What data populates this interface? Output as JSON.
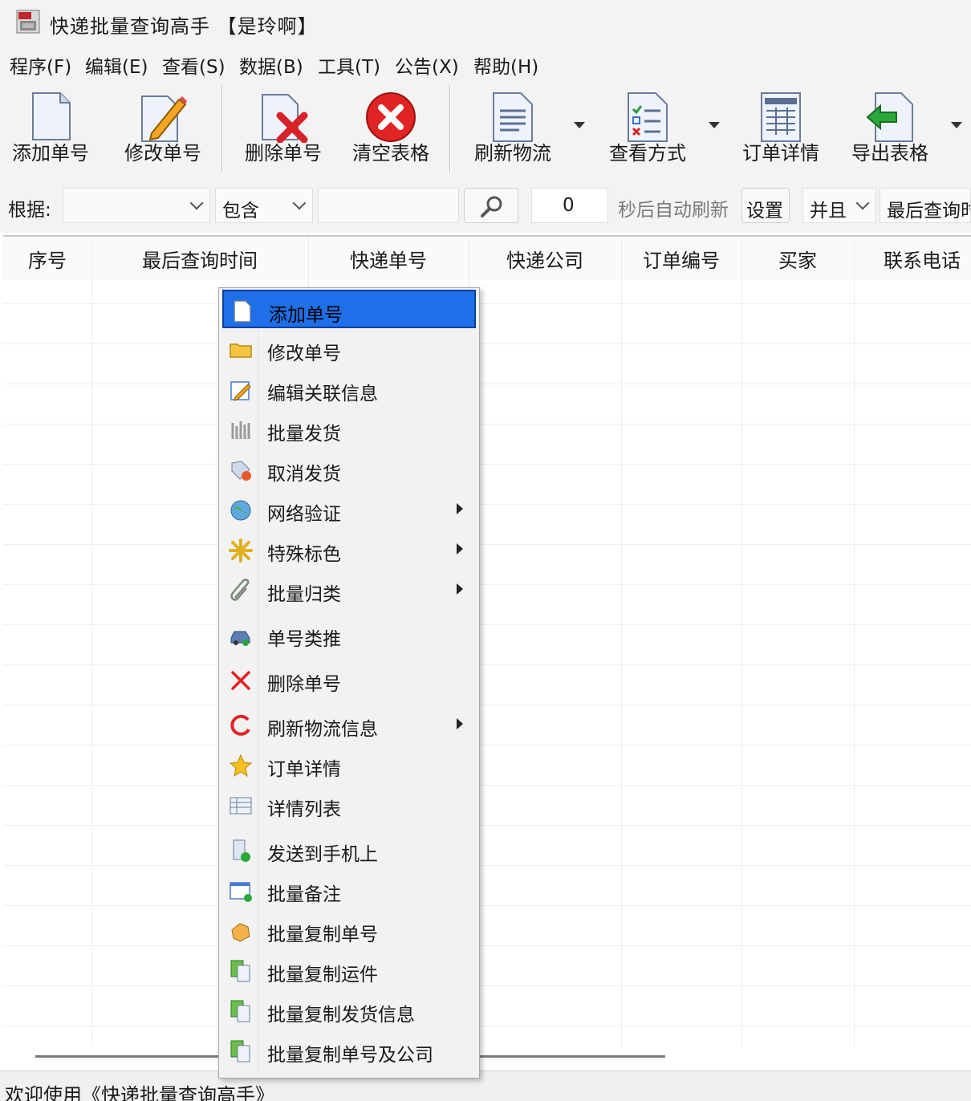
{
  "window": {
    "title": "快递批量查询高手 【是玲啊】"
  },
  "menubar": [
    "程序(F)",
    "编辑(E)",
    "查看(S)",
    "数据(B)",
    "工具(T)",
    "公告(X)",
    "帮助(H)"
  ],
  "toolbar": {
    "add": "添加单号",
    "edit": "修改单号",
    "delete": "删除单号",
    "clear": "清空表格",
    "refresh": "刷新物流",
    "view_mode": "查看方式",
    "order_detail": "订单详情",
    "export": "导出表格"
  },
  "filter": {
    "label": "根据:",
    "field_value": "",
    "match_value": "包含",
    "query_value": "",
    "seconds_value": "0",
    "auto_refresh_label": "秒后自动刷新",
    "settings_button": "设置",
    "logic_value": "并且",
    "last_query_label": "最后查询时"
  },
  "grid": {
    "columns": [
      "序号",
      "最后查询时间",
      "快递单号",
      "快递公司",
      "订单编号",
      "买家",
      "联系电话"
    ]
  },
  "context_menu": {
    "items": [
      {
        "label": "添加单号",
        "icon": "blank-page-icon",
        "submenu": false,
        "selected": true
      },
      {
        "label": "修改单号",
        "icon": "folder-icon",
        "submenu": false
      },
      {
        "label": "编辑关联信息",
        "icon": "edit-pencil-icon",
        "submenu": false
      },
      {
        "label": "批量发货",
        "icon": "bars-icon",
        "submenu": false
      },
      {
        "label": "取消发货",
        "icon": "tag-cancel-icon",
        "submenu": false
      },
      {
        "label": "网络验证",
        "icon": "globe-icon",
        "submenu": true
      },
      {
        "label": "特殊标色",
        "icon": "star-burst-icon",
        "submenu": true
      },
      {
        "label": "批量归类",
        "icon": "paperclip-icon",
        "submenu": true
      },
      {
        "label": "单号类推",
        "icon": "car-icon",
        "submenu": false
      },
      {
        "label": "删除单号",
        "icon": "red-x-icon",
        "submenu": false
      },
      {
        "label": "刷新物流信息",
        "icon": "refresh-icon",
        "submenu": true
      },
      {
        "label": "订单详情",
        "icon": "star-icon",
        "submenu": false
      },
      {
        "label": "详情列表",
        "icon": "list-table-icon",
        "submenu": false
      },
      {
        "label": "发送到手机上",
        "icon": "send-phone-icon",
        "submenu": false
      },
      {
        "label": "批量备注",
        "icon": "note-window-icon",
        "submenu": false
      },
      {
        "label": "批量复制单号",
        "icon": "hand-copy-icon",
        "submenu": false
      },
      {
        "label": "批量复制运件",
        "icon": "copy-docs-icon",
        "submenu": false
      },
      {
        "label": "批量复制发货信息",
        "icon": "copy-docs-icon",
        "submenu": false
      },
      {
        "label": "批量复制单号及公司",
        "icon": "copy-docs-icon",
        "submenu": false
      }
    ]
  },
  "status": {
    "text": "欢迎使用《快递批量查询高手》"
  },
  "colors": {
    "selection": "#1e6fe8",
    "chrome": "#f3f3f3",
    "danger": "#e02424"
  }
}
